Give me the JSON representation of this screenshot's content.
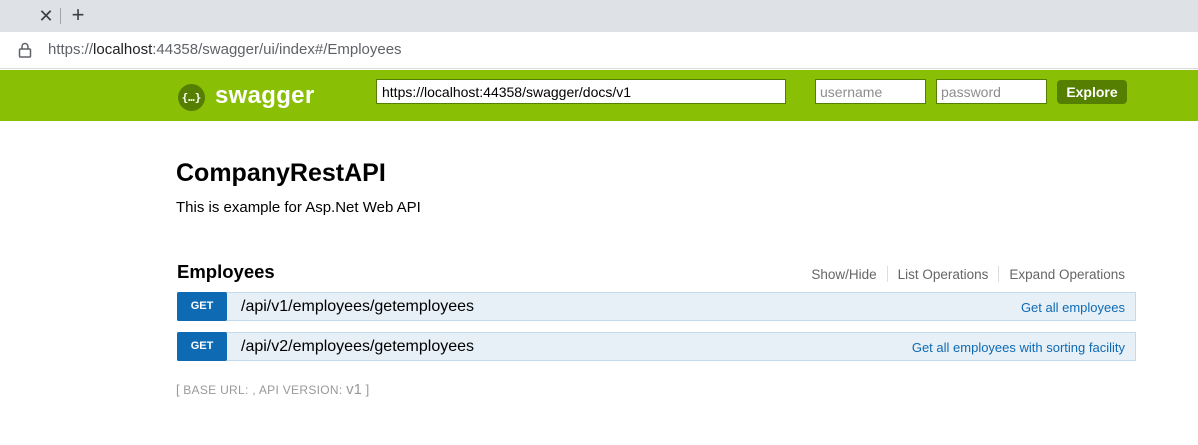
{
  "browser": {
    "address": {
      "scheme": "https://",
      "host": "localhost",
      "rest": ":44358/swagger/ui/index#/Employees"
    },
    "tab_close_glyph": "✕",
    "new_tab_glyph": "+"
  },
  "header": {
    "logo_glyph": "{…}",
    "logo_text": "swagger",
    "api_url": "https://localhost:44358/swagger/docs/v1",
    "username_placeholder": "username",
    "password_placeholder": "password",
    "explore_label": "Explore",
    "colors": {
      "bar": "#89bf04",
      "accent": "#547f00"
    }
  },
  "info": {
    "title": "CompanyRestAPI",
    "description": "This is example for Asp.Net Web API"
  },
  "resource": {
    "name": "Employees",
    "actions": [
      "Show/Hide",
      "List Operations",
      "Expand Operations"
    ],
    "operations": [
      {
        "method": "GET",
        "path": "/api/v1/employees/getemployees",
        "summary": "Get all employees"
      },
      {
        "method": "GET",
        "path": "/api/v2/employees/getemployees",
        "summary": "Get all employees with sorting facility"
      }
    ]
  },
  "footer": {
    "open": "[ ",
    "base_url_label": "BASE URL",
    "base_url_value": ": , ",
    "api_version_label": "API VERSION",
    "api_version_sep": ": ",
    "api_version_value": "v1",
    "close": " ]"
  }
}
